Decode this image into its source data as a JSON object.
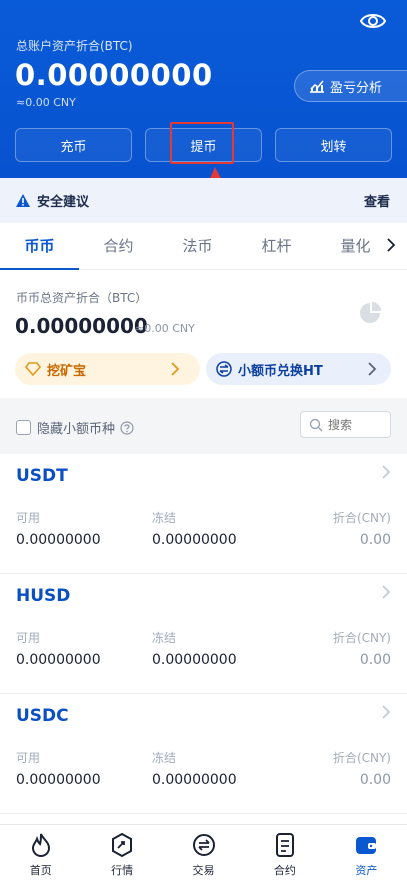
{
  "header": {
    "total_label": "总账户资产折合(BTC)",
    "total_value": "0.00000000",
    "total_cny": "≈0.00 CNY",
    "pl_label": "盈亏分析",
    "actions": [
      "充币",
      "提币",
      "划转"
    ]
  },
  "security": {
    "label": "安全建议",
    "link": "查看"
  },
  "tabs": [
    "币币",
    "合约",
    "法币",
    "杠杆",
    "量化"
  ],
  "spot": {
    "label": "币币总资产折合（BTC）",
    "value": "0.00000000",
    "cny": "≈0.00 CNY",
    "mining_label": "挖矿宝",
    "convert_label": "小额币兑换HT"
  },
  "filter": {
    "hide_label": "隐藏小额币种",
    "search_placeholder": "搜索"
  },
  "coins": [
    {
      "name": "USDT",
      "available_label": "可用",
      "frozen_label": "冻结",
      "cny_label": "折合(CNY)",
      "available": "0.00000000",
      "frozen": "0.00000000",
      "cny": "0.00"
    },
    {
      "name": "HUSD",
      "available_label": "可用",
      "frozen_label": "冻结",
      "cny_label": "折合(CNY)",
      "available": "0.00000000",
      "frozen": "0.00000000",
      "cny": "0.00"
    },
    {
      "name": "USDC",
      "available_label": "可用",
      "frozen_label": "冻结",
      "cny_label": "折合(CNY)",
      "available": "0.00000000",
      "frozen": "0.00000000",
      "cny": "0.00"
    }
  ],
  "nav": [
    {
      "label": "首页",
      "icon": "flame-icon"
    },
    {
      "label": "行情",
      "icon": "market-icon"
    },
    {
      "label": "交易",
      "icon": "trade-icon"
    },
    {
      "label": "合约",
      "icon": "contract-icon"
    },
    {
      "label": "资产",
      "icon": "wallet-icon"
    }
  ],
  "colors": {
    "brand_blue": "#0b57d0",
    "highlight_red": "#e53935",
    "mining_orange": "#c86a00"
  }
}
